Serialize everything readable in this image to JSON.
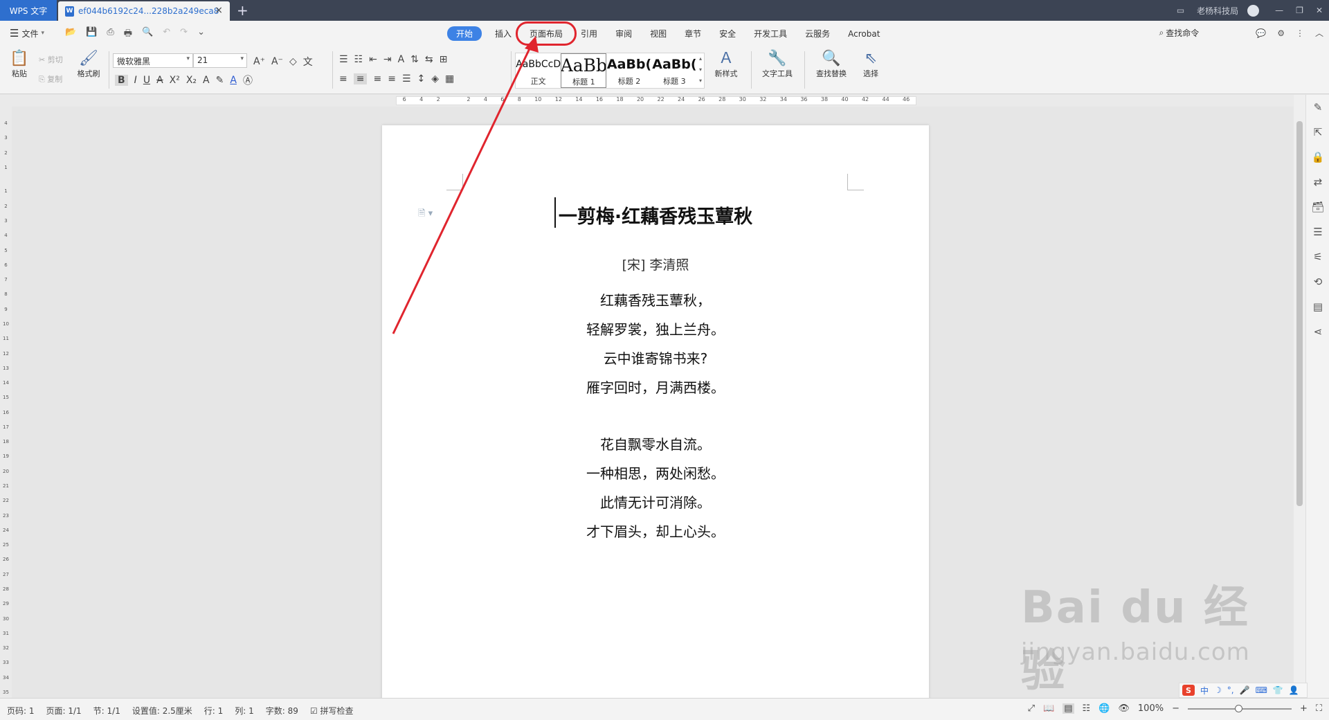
{
  "titlebar": {
    "app_tab": "WPS 文字",
    "doc_tab": "ef044b6192c24...228b2a249eca8",
    "doc_icon": "W",
    "close_glyph": "×",
    "add_glyph": "+",
    "user": "老杨科技局",
    "min_glyph": "—",
    "max_glyph": "❐",
    "close_win_glyph": "✕"
  },
  "menu": {
    "file_label": "文件",
    "tabs": [
      "开始",
      "插入",
      "页面布局",
      "引用",
      "审阅",
      "视图",
      "章节",
      "安全",
      "开发工具",
      "云服务",
      "Acrobat"
    ],
    "active_tab": "开始",
    "highlighted_tab": "页面布局",
    "search_label": "查找命令"
  },
  "ribbon": {
    "paste": "粘贴",
    "cut": "剪切",
    "copy": "复制",
    "format_painter": "格式刷",
    "font_name": "微软雅黑",
    "font_size": "21",
    "styles": [
      {
        "preview": "AaBbCcD",
        "name": "正文"
      },
      {
        "preview": "AaBb",
        "name": "标题 1"
      },
      {
        "preview": "AaBb(",
        "name": "标题 2"
      },
      {
        "preview": "AaBb(",
        "name": "标题 3"
      }
    ],
    "new_style": "新样式",
    "text_tools": "文字工具",
    "find_replace": "查找替换",
    "select": "选择"
  },
  "ruler_ticks": [
    "6",
    "4",
    "2",
    "",
    "2",
    "4",
    "6",
    "8",
    "10",
    "12",
    "14",
    "16",
    "18",
    "20",
    "22",
    "24",
    "26",
    "28",
    "30",
    "32",
    "34",
    "36",
    "38",
    "40",
    "42",
    "44",
    "46"
  ],
  "vruler_ticks": [
    "4",
    "3",
    "2",
    "1",
    "",
    "1",
    "2",
    "3",
    "4",
    "5",
    "6",
    "7",
    "8",
    "9",
    "10",
    "11",
    "12",
    "13",
    "14",
    "15",
    "16",
    "17",
    "18",
    "19",
    "20",
    "21",
    "22",
    "23",
    "24",
    "25",
    "26",
    "27",
    "28",
    "29",
    "30",
    "31",
    "32",
    "33",
    "34",
    "35"
  ],
  "document": {
    "title": "一剪梅·红藕香残玉蕈秋",
    "author": "[宋]  李清照",
    "stanza1": [
      "红藕香残玉蕈秋，",
      "轻解罗裳，独上兰舟。",
      "云中谁寄锦书来?",
      "雁字回时，月满西楼。"
    ],
    "stanza2": [
      "花自飘零水自流。",
      "一种相思，两处闲愁。",
      "此情无计可消除。",
      "才下眉头，却上心头。"
    ]
  },
  "status": {
    "page_code": "页码: 1",
    "pages": "页面: 1/1",
    "section": "节: 1/1",
    "setting": "设置值: 2.5厘米",
    "row": "行: 1",
    "col": "列: 1",
    "word_count": "字数: 89",
    "spell_check": "拼写检查",
    "zoom": "100%"
  },
  "ime": {
    "logo": "S",
    "mode": "中"
  },
  "watermark": {
    "main": "Bai du 经验",
    "sub": "jingyan.baidu.com"
  },
  "colors": {
    "accent": "#3d82e5",
    "annotation": "#e0252e",
    "titlebar": "#3c4454"
  }
}
